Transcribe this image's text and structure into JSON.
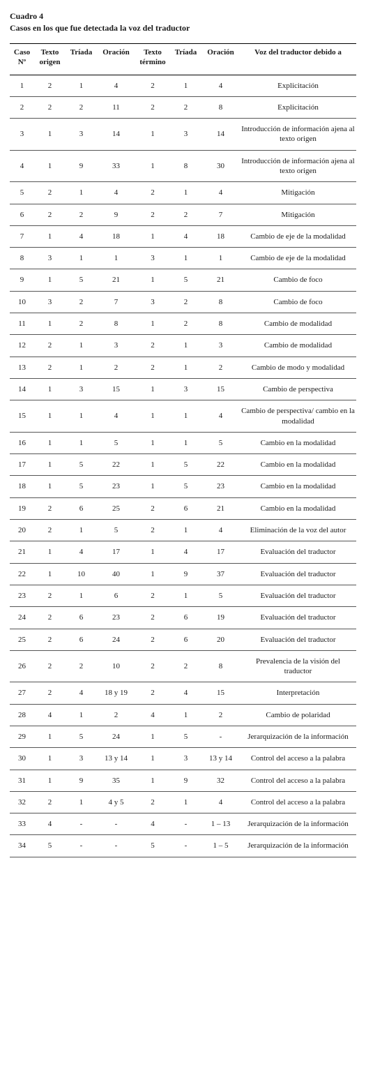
{
  "title": "Cuadro 4",
  "subtitle": "Casos en los que fue detectada la voz del traductor",
  "headers": {
    "h1": "Caso Nº",
    "h2": "Texto origen",
    "h3": "Tríada",
    "h4": "Oración",
    "h5": "Texto término",
    "h6": "Tríada",
    "h7": "Oración",
    "h8": "Voz del traduc­tor debido a"
  },
  "rows": [
    {
      "n": "1",
      "to": "2",
      "t1": "1",
      "o1": "4",
      "tt": "2",
      "t2": "1",
      "o2": "4",
      "r": "Explicitación"
    },
    {
      "n": "2",
      "to": "2",
      "t1": "2",
      "o1": "11",
      "tt": "2",
      "t2": "2",
      "o2": "8",
      "r": "Explicitación"
    },
    {
      "n": "3",
      "to": "1",
      "t1": "3",
      "o1": "14",
      "tt": "1",
      "t2": "3",
      "o2": "14",
      "r": "Introducción de información ajena al texto origen"
    },
    {
      "n": "4",
      "to": "1",
      "t1": "9",
      "o1": "33",
      "tt": "1",
      "t2": "8",
      "o2": "30",
      "r": "Introducción de información ajena al texto origen"
    },
    {
      "n": "5",
      "to": "2",
      "t1": "1",
      "o1": "4",
      "tt": "2",
      "t2": "1",
      "o2": "4",
      "r": "Mitigación"
    },
    {
      "n": "6",
      "to": "2",
      "t1": "2",
      "o1": "9",
      "tt": "2",
      "t2": "2",
      "o2": "7",
      "r": "Mitigación"
    },
    {
      "n": "7",
      "to": "1",
      "t1": "4",
      "o1": "18",
      "tt": "1",
      "t2": "4",
      "o2": "18",
      "r": "Cambio de eje de la modalidad"
    },
    {
      "n": "8",
      "to": "3",
      "t1": "1",
      "o1": "1",
      "tt": "3",
      "t2": "1",
      "o2": "1",
      "r": "Cambio de eje de la modalidad"
    },
    {
      "n": "9",
      "to": "1",
      "t1": "5",
      "o1": "21",
      "tt": "1",
      "t2": "5",
      "o2": "21",
      "r": "Cambio de foco"
    },
    {
      "n": "10",
      "to": "3",
      "t1": "2",
      "o1": "7",
      "tt": "3",
      "t2": "2",
      "o2": "8",
      "r": "Cambio de foco"
    },
    {
      "n": "11",
      "to": "1",
      "t1": "2",
      "o1": "8",
      "tt": "1",
      "t2": "2",
      "o2": "8",
      "r": "Cambio de modalidad"
    },
    {
      "n": "12",
      "to": "2",
      "t1": "1",
      "o1": "3",
      "tt": "2",
      "t2": "1",
      "o2": "3",
      "r": "Cambio de modalidad"
    },
    {
      "n": "13",
      "to": "2",
      "t1": "1",
      "o1": "2",
      "tt": "2",
      "t2": "1",
      "o2": "2",
      "r": "Cambio de modo y modalidad"
    },
    {
      "n": "14",
      "to": "1",
      "t1": "3",
      "o1": "15",
      "tt": "1",
      "t2": "3",
      "o2": "15",
      "r": "Cambio de perspectiva"
    },
    {
      "n": "15",
      "to": "1",
      "t1": "1",
      "o1": "4",
      "tt": "1",
      "t2": "1",
      "o2": "4",
      "r": "Cambio de perspectiva/ cambio en la modalidad"
    },
    {
      "n": "16",
      "to": "1",
      "t1": "1",
      "o1": "5",
      "tt": "1",
      "t2": "1",
      "o2": "5",
      "r": "Cambio en la modalidad"
    },
    {
      "n": "17",
      "to": "1",
      "t1": "5",
      "o1": "22",
      "tt": "1",
      "t2": "5",
      "o2": "22",
      "r": "Cambio en la modalidad"
    },
    {
      "n": "18",
      "to": "1",
      "t1": "5",
      "o1": "23",
      "tt": "1",
      "t2": "5",
      "o2": "23",
      "r": "Cambio en la modalidad"
    },
    {
      "n": "19",
      "to": "2",
      "t1": "6",
      "o1": "25",
      "tt": "2",
      "t2": "6",
      "o2": "21",
      "r": "Cambio en la modalidad"
    },
    {
      "n": "20",
      "to": "2",
      "t1": "1",
      "o1": "5",
      "tt": "2",
      "t2": "1",
      "o2": "4",
      "r": "Eliminación de la voz del autor"
    },
    {
      "n": "21",
      "to": "1",
      "t1": "4",
      "o1": "17",
      "tt": "1",
      "t2": "4",
      "o2": "17",
      "r": "Evaluación del traductor"
    },
    {
      "n": "22",
      "to": "1",
      "t1": "10",
      "o1": "40",
      "tt": "1",
      "t2": "9",
      "o2": "37",
      "r": "Evaluación del traductor"
    },
    {
      "n": "23",
      "to": "2",
      "t1": "1",
      "o1": "6",
      "tt": "2",
      "t2": "1",
      "o2": "5",
      "r": "Evaluación del traductor"
    },
    {
      "n": "24",
      "to": "2",
      "t1": "6",
      "o1": "23",
      "tt": "2",
      "t2": "6",
      "o2": "19",
      "r": "Evaluación del traductor"
    },
    {
      "n": "25",
      "to": "2",
      "t1": "6",
      "o1": "24",
      "tt": "2",
      "t2": "6",
      "o2": "20",
      "r": "Evaluación del traductor"
    },
    {
      "n": "26",
      "to": "2",
      "t1": "2",
      "o1": "10",
      "tt": "2",
      "t2": "2",
      "o2": "8",
      "r": "Prevalencia de la visión del traductor"
    },
    {
      "n": "27",
      "to": "2",
      "t1": "4",
      "o1": "18 y 19",
      "tt": "2",
      "t2": "4",
      "o2": "15",
      "r": "Interpretación"
    },
    {
      "n": "28",
      "to": "4",
      "t1": "1",
      "o1": "2",
      "tt": "4",
      "t2": "1",
      "o2": "2",
      "r": "Cambio de polaridad"
    },
    {
      "n": "29",
      "to": "1",
      "t1": "5",
      "o1": "24",
      "tt": "1",
      "t2": "5",
      "o2": "-",
      "r": "Jerarquización de la información"
    },
    {
      "n": "30",
      "to": "1",
      "t1": "3",
      "o1": "13 y 14",
      "tt": "1",
      "t2": "3",
      "o2": "13 y 14",
      "r": "Control del acceso a la palabra"
    },
    {
      "n": "31",
      "to": "1",
      "t1": "9",
      "o1": "35",
      "tt": "1",
      "t2": "9",
      "o2": "32",
      "r": "Control del acceso a la palabra"
    },
    {
      "n": "32",
      "to": "2",
      "t1": "1",
      "o1": "4 y 5",
      "tt": "2",
      "t2": "1",
      "o2": "4",
      "r": "Control del acceso a la palabra"
    },
    {
      "n": "33",
      "to": "4",
      "t1": "-",
      "o1": "-",
      "tt": "4",
      "t2": "-",
      "o2": "1 – 13",
      "r": "Jerarquización de la información"
    },
    {
      "n": "34",
      "to": "5",
      "t1": "-",
      "o1": "-",
      "tt": "5",
      "t2": "-",
      "o2": "1 – 5",
      "r": "Jerarquización de la información"
    }
  ]
}
